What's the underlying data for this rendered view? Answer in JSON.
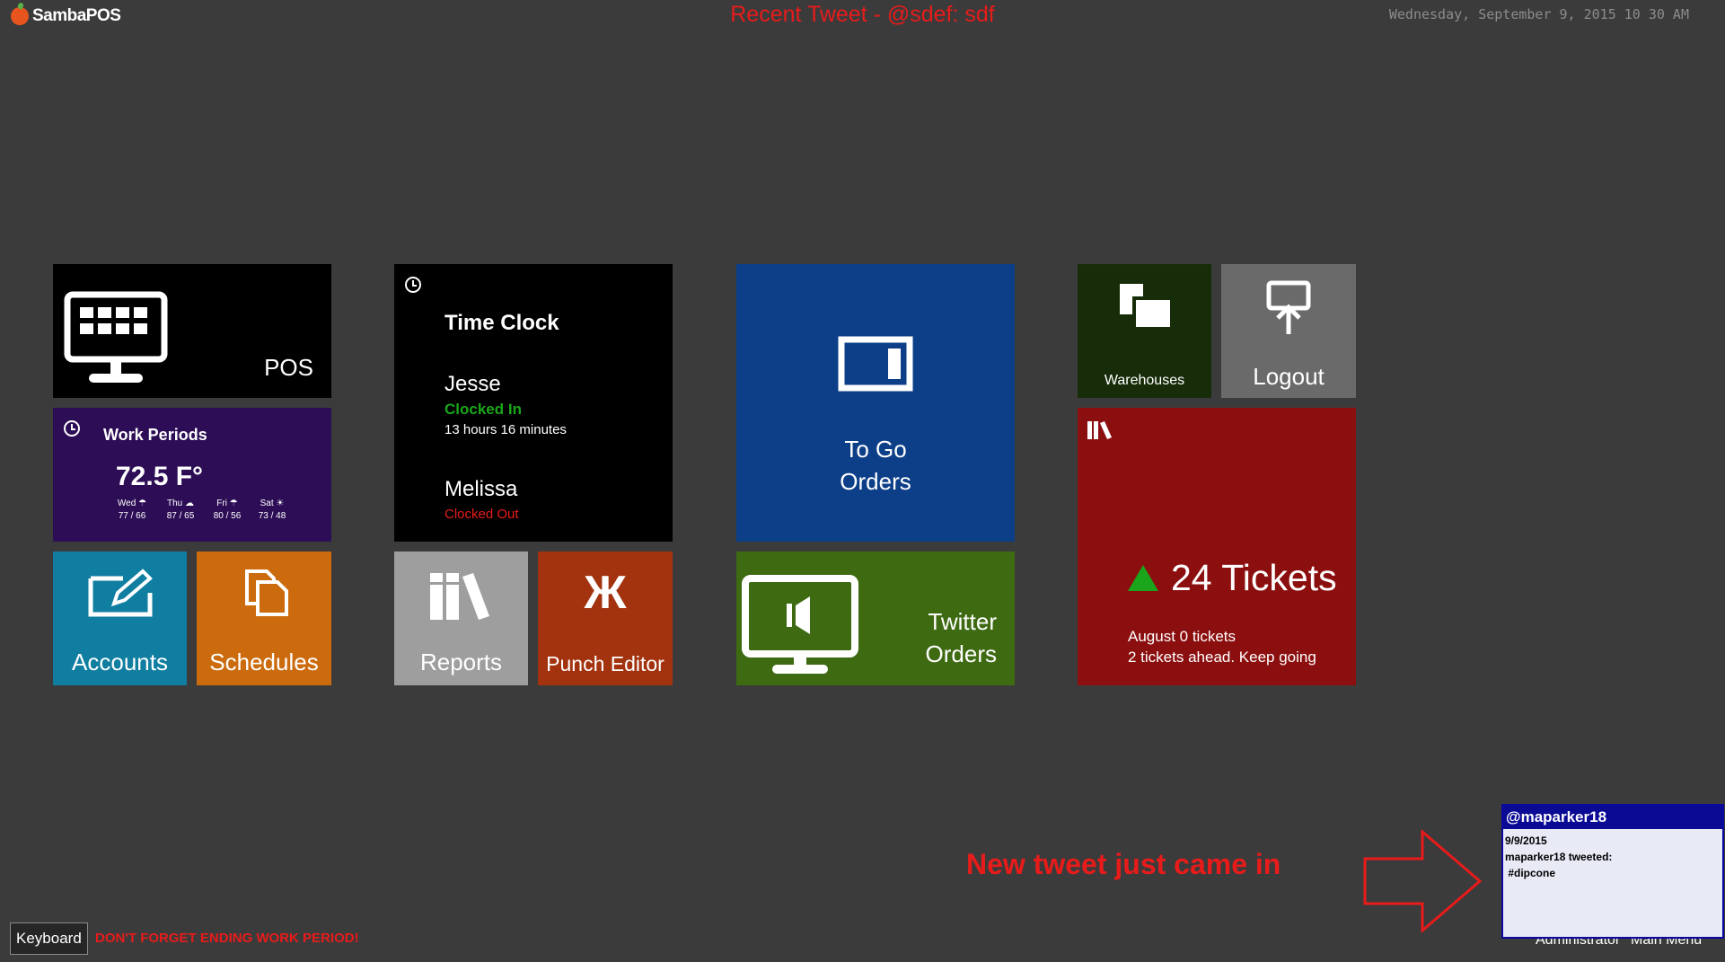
{
  "app": {
    "name": "SambaPOS"
  },
  "header": {
    "recent_tweet": "Recent Tweet - @sdef: sdf",
    "datetime": "Wednesday, September 9, 2015 10 30 AM"
  },
  "tiles": {
    "pos": {
      "label": "POS",
      "icon": "pos-terminal-icon"
    },
    "work_periods": {
      "label": "Work Periods",
      "icon": "clock-icon",
      "temperature": "72.5 F°",
      "forecast": [
        {
          "day": "Wed",
          "icon": "rain-icon",
          "range": "77 / 66"
        },
        {
          "day": "Thu",
          "icon": "cloud-icon",
          "range": "87 / 65"
        },
        {
          "day": "Fri",
          "icon": "rain-icon",
          "range": "80 / 56"
        },
        {
          "day": "Sat",
          "icon": "sun-icon",
          "range": "73 / 48"
        }
      ]
    },
    "accounts": {
      "label": "Accounts",
      "icon": "edit-icon"
    },
    "schedules": {
      "label": "Schedules",
      "icon": "copy-icon"
    },
    "time_clock": {
      "label": "Time Clock",
      "icon": "clock-icon",
      "entries": [
        {
          "name": "Jesse",
          "status": "Clocked In",
          "duration": "13 hours 16 minutes",
          "status_color": "#1aa51a"
        },
        {
          "name": "Melissa",
          "status": "Clocked Out",
          "duration": "",
          "status_color": "#e81b1b"
        }
      ]
    },
    "reports": {
      "label": "Reports",
      "icon": "books-icon"
    },
    "punch_editor": {
      "label": "Punch Editor",
      "icon": "kappa-icon"
    },
    "to_go_orders": {
      "label_line1": "To Go",
      "label_line2": "Orders",
      "icon": "tablet-icon"
    },
    "twitter_orders": {
      "label_line1": "Twitter",
      "label_line2": "Orders",
      "icon": "monitor-speaker-icon"
    },
    "warehouses": {
      "label": "Warehouses",
      "icon": "windows-stack-icon"
    },
    "logout": {
      "label": "Logout",
      "icon": "logout-monitor-icon"
    },
    "tickets": {
      "icon": "books-icon",
      "headline": "24 Tickets",
      "trend": "up",
      "line1": "August 0 tickets",
      "line2": "2 tickets ahead. Keep going"
    }
  },
  "footer": {
    "keyboard_button": "Keyboard",
    "warning": "DON'T FORGET ENDING WORK PERIOD!",
    "user_button": "Administrator",
    "main_menu_button": "Main Menu"
  },
  "annotation": {
    "text": "New tweet just came in",
    "arrow": "right-arrow-outline"
  },
  "notification": {
    "handle": "@maparker18",
    "date": "9/9/2015",
    "line": "maparker18 tweeted:",
    "tweet": " #dipcone"
  },
  "colors": {
    "background": "#3b3b3b",
    "alert_red": "#e81b1b",
    "pos": "#000000",
    "work_periods": "#2d0e56",
    "accounts": "#0f7ea1",
    "schedules": "#cc6b0e",
    "reports": "#9e9e9e",
    "punch_editor": "#a2330e",
    "to_go_orders": "#0d3f88",
    "twitter_orders": "#3e6a12",
    "warehouses": "#172d0a",
    "logout": "#6a6a6a",
    "tickets": "#8c0f0f",
    "notification_header": "#0a0a95"
  }
}
